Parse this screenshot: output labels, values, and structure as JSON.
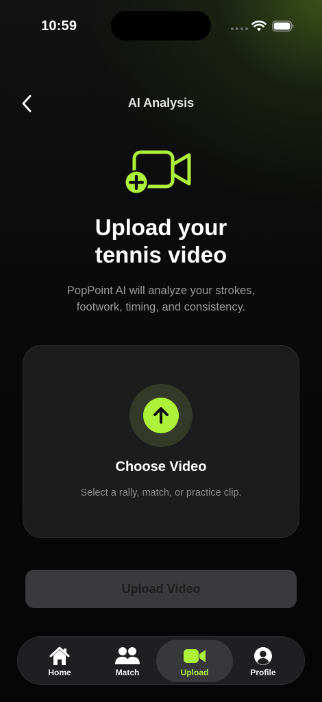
{
  "status_bar": {
    "time": "10:59"
  },
  "header": {
    "title": "AI Analysis",
    "back_icon": "chevron-left-icon"
  },
  "hero": {
    "icon": "video-add-icon",
    "title_lines": [
      "Upload your",
      "tennis video"
    ],
    "subtitle_lines": [
      "PopPoint AI will analyze your strokes,",
      "footwork, timing, and consistency."
    ]
  },
  "choose_card": {
    "icon": "arrow-up-icon",
    "title": "Choose Video",
    "subtitle": "Select a rally, match, or practice clip."
  },
  "upload_button": {
    "label": "Upload Video"
  },
  "tabs": [
    {
      "label": "Home",
      "icon": "home-icon",
      "active": false
    },
    {
      "label": "Match",
      "icon": "people-icon",
      "active": false
    },
    {
      "label": "Upload",
      "icon": "video-icon",
      "active": true
    },
    {
      "label": "Profile",
      "icon": "profile-icon",
      "active": false
    }
  ],
  "colors": {
    "accent": "#aef13a",
    "background": "#0a0a0a",
    "card": "#1c1c1d",
    "button_disabled": "#3a3a3c",
    "text_muted": "#9a9a9a"
  }
}
